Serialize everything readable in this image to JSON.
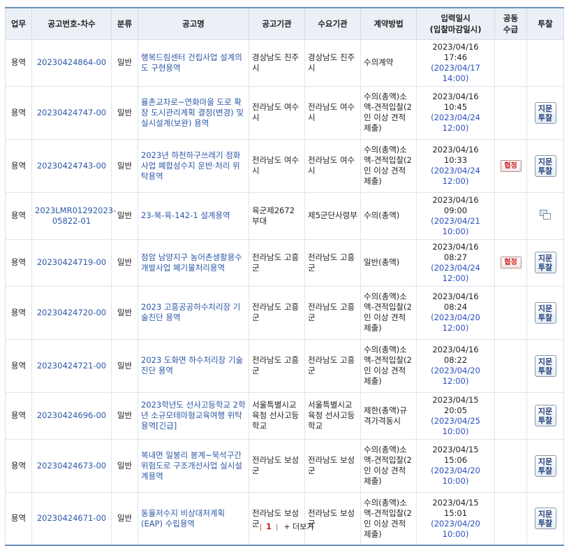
{
  "headers": {
    "business": "업무",
    "notice_no": "공고번호-차수",
    "category": "분류",
    "title": "공고명",
    "agency": "공고기관",
    "demand": "수요기관",
    "contract": "계약방법",
    "date_line1": "입력일시",
    "date_line2": "(입찰마감일시)",
    "joint_line1": "공동",
    "joint_line2": "수급",
    "bid": "투찰"
  },
  "bid_button_line1": "지문",
  "bid_button_line2": "투찰",
  "joint_badge": "협정",
  "rows": [
    {
      "business": "용역",
      "notice_no": "20230424864-00",
      "category": "일반",
      "title": "행복드림센터 건립사업 설계의도 구현용역",
      "agency": "경상남도 진주시",
      "demand": "경상남도 진주시",
      "contract": "수의계약",
      "input_dt": "2023/04/16 17:46",
      "deadline": "(2023/04/17 14:00)"
    },
    {
      "business": "용역",
      "notice_no": "20230424747-00",
      "category": "일반",
      "title": "율촌교차로~연화마을 도로 확장 도시관리계획 결정(변경) 및 실시설계(보완) 용역",
      "agency": "전라남도 여수시",
      "demand": "전라남도 여수시",
      "contract": "수의(총액)소액-견적입찰(2인 이상 견적 제출)",
      "input_dt": "2023/04/16 10:45",
      "deadline": "(2023/04/24 12:00)"
    },
    {
      "business": "용역",
      "notice_no": "20230424743-00",
      "category": "일반",
      "title": "2023년 하천하구쓰레기 정화사업 폐합성수지 운반·처리 위탁용역",
      "agency": "전라남도 여수시",
      "demand": "전라남도 여수시",
      "contract": "수의(총액)소액-견적입찰(2인 이상 견적 제출)",
      "input_dt": "2023/04/16 10:33",
      "deadline": "(2023/04/24 12:00)"
    },
    {
      "business": "용역",
      "notice_no": "2023LMR01292023-05822-01",
      "category": "일반",
      "title": "23-북-육-142-1 설계용역",
      "agency": "육군제2672부대",
      "demand": "제5군단사령부",
      "contract": "수의(총액)",
      "input_dt": "2023/04/16 09:00",
      "deadline": "(2023/04/21 10:00)"
    },
    {
      "business": "용역",
      "notice_no": "20230424719-00",
      "category": "일반",
      "title": "점암 남양지구 농어촌생활용수개발사업 폐기물처리용역",
      "agency": "전라남도 고흥군",
      "demand": "전라남도 고흥군",
      "contract": "일반(총액)",
      "input_dt": "2023/04/16 08:27",
      "deadline": "(2023/04/24 12:00)"
    },
    {
      "business": "용역",
      "notice_no": "20230424720-00",
      "category": "일반",
      "title": "2023 고흥공공하수처리장 기술진단 용역",
      "agency": "전라남도 고흥군",
      "demand": "전라남도 고흥군",
      "contract": "수의(총액)소액-견적입찰(2인 이상 견적 제출)",
      "input_dt": "2023/04/16 08:24",
      "deadline": "(2023/04/20 12:00)"
    },
    {
      "business": "용역",
      "notice_no": "20230424721-00",
      "category": "일반",
      "title": "2023 도화면 하수처리장 기술진단 용역",
      "agency": "전라남도 고흥군",
      "demand": "전라남도 고흥군",
      "contract": "수의(총액)소액-견적입찰(2인 이상 견적 제출)",
      "input_dt": "2023/04/16 08:22",
      "deadline": "(2023/04/20 12:00)"
    },
    {
      "business": "용역",
      "notice_no": "20230424696-00",
      "category": "일반",
      "title": "2023학년도 선사고등학교 2학년 소규모테마형교육여행 위탁용역[긴급]",
      "agency": "서울특별시교육청 선사고등학교",
      "demand": "서울특별시교육청 선사고등학교",
      "contract": "제한(총액)규격가격동시",
      "input_dt": "2023/04/15 20:05",
      "deadline": "(2023/04/25 10:00)"
    },
    {
      "business": "용역",
      "notice_no": "20230424673-00",
      "category": "일반",
      "title": "복내면 일봉리 봉계~묵석구간 위험도로 구조개선사업 실시설계용역",
      "agency": "전라남도 보성군",
      "demand": "전라남도 보성군",
      "contract": "수의(총액)소액-견적입찰(2인 이상 견적 제출)",
      "input_dt": "2023/04/15 15:06",
      "deadline": "(2023/04/20 10:00)"
    },
    {
      "business": "용역",
      "notice_no": "20230424671-00",
      "category": "일반",
      "title": "동율저수지 비상대처계획(EAP) 수립용역",
      "agency": "전라남도 보성군",
      "demand": "전라남도 보성군",
      "contract": "수의(총액)소액-견적입찰(2인 이상 견적 제출)",
      "input_dt": "2023/04/15 15:01",
      "deadline": "(2023/04/20 10:00)"
    }
  ],
  "pagination": {
    "current": "1",
    "more": "+ 더보기",
    "separator": "|"
  }
}
